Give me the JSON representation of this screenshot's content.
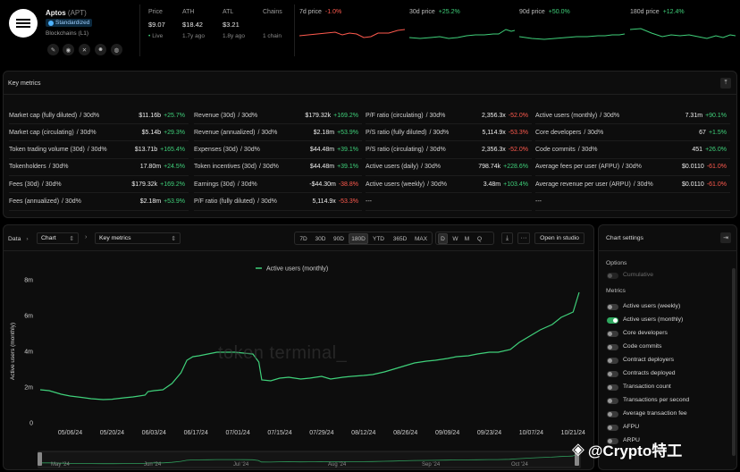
{
  "project": {
    "name": "Aptos",
    "ticker": "(APT)",
    "badge": "Standardized",
    "category": "Blockchains (L1)"
  },
  "header_stats": [
    {
      "label": "Price",
      "value": "$9.07",
      "sub": "Live"
    },
    {
      "label": "ATH",
      "value": "$18.42",
      "sub": "1.7y ago"
    },
    {
      "label": "ATL",
      "value": "$3.21",
      "sub": "1.8y ago"
    },
    {
      "label": "Chains",
      "value": "",
      "sub": "1 chain"
    }
  ],
  "price_changes": [
    {
      "label": "7d price",
      "change": "-1.0%",
      "color": "#ff5a4e"
    },
    {
      "label": "30d price",
      "change": "+25.2%",
      "color": "#3fd07a"
    },
    {
      "label": "90d price",
      "change": "+50.0%",
      "color": "#3fd07a"
    },
    {
      "label": "180d price",
      "change": "+12.4%",
      "color": "#3fd07a"
    }
  ],
  "key_metrics": {
    "title": "Key metrics",
    "columns": [
      [
        {
          "label": "Market cap (fully diluted)",
          "period": "/ 30d%",
          "value": "$11.16b",
          "change": "+25.7%",
          "dir": "up"
        },
        {
          "label": "Market cap (circulating)",
          "period": "/ 30d%",
          "value": "$5.14b",
          "change": "+29.3%",
          "dir": "up"
        },
        {
          "label": "Token trading volume (30d)",
          "period": "/ 30d%",
          "value": "$13.71b",
          "change": "+165.4%",
          "dir": "up"
        },
        {
          "label": "Tokenholders",
          "period": "/ 30d%",
          "value": "17.80m",
          "change": "+24.5%",
          "dir": "up"
        },
        {
          "label": "Fees (30d)",
          "period": "/ 30d%",
          "value": "$179.32k",
          "change": "+169.2%",
          "dir": "up"
        },
        {
          "label": "Fees (annualized)",
          "period": "/ 30d%",
          "value": "$2.18m",
          "change": "+53.9%",
          "dir": "up"
        }
      ],
      [
        {
          "label": "Revenue (30d)",
          "period": "/ 30d%",
          "value": "$179.32k",
          "change": "+169.2%",
          "dir": "up"
        },
        {
          "label": "Revenue (annualized)",
          "period": "/ 30d%",
          "value": "$2.18m",
          "change": "+53.9%",
          "dir": "up"
        },
        {
          "label": "Expenses (30d)",
          "period": "/ 30d%",
          "value": "$44.48m",
          "change": "+39.1%",
          "dir": "up"
        },
        {
          "label": "Token incentives (30d)",
          "period": "/ 30d%",
          "value": "$44.48m",
          "change": "+39.1%",
          "dir": "up"
        },
        {
          "label": "Earnings (30d)",
          "period": "/ 30d%",
          "value": "-$44.30m",
          "change": "-38.8%",
          "dir": "down"
        },
        {
          "label": "P/F ratio (fully diluted)",
          "period": "/ 30d%",
          "value": "5,114.9x",
          "change": "-53.3%",
          "dir": "down"
        }
      ],
      [
        {
          "label": "P/F ratio (circulating)",
          "period": "/ 30d%",
          "value": "2,356.3x",
          "change": "-52.0%",
          "dir": "down"
        },
        {
          "label": "P/S ratio (fully diluted)",
          "period": "/ 30d%",
          "value": "5,114.9x",
          "change": "-53.3%",
          "dir": "down"
        },
        {
          "label": "P/S ratio (circulating)",
          "period": "/ 30d%",
          "value": "2,356.3x",
          "change": "-52.0%",
          "dir": "down"
        },
        {
          "label": "Active users (daily)",
          "period": "/ 30d%",
          "value": "798.74k",
          "change": "+228.6%",
          "dir": "up"
        },
        {
          "label": "Active users (weekly)",
          "period": "/ 30d%",
          "value": "3.48m",
          "change": "+103.4%",
          "dir": "up"
        },
        {
          "label": "---",
          "period": "",
          "value": "",
          "change": "",
          "dir": "up"
        }
      ],
      [
        {
          "label": "Active users (monthly)",
          "period": "/ 30d%",
          "value": "7.31m",
          "change": "+90.1%",
          "dir": "up"
        },
        {
          "label": "Core developers",
          "period": "/ 30d%",
          "value": "67",
          "change": "+1.5%",
          "dir": "up"
        },
        {
          "label": "Code commits",
          "period": "/ 30d%",
          "value": "451",
          "change": "+26.0%",
          "dir": "up"
        },
        {
          "label": "Average fees per user (AFPU)",
          "period": "/ 30d%",
          "value": "$0.0110",
          "change": "-61.0%",
          "dir": "down"
        },
        {
          "label": "Average revenue per user (ARPU)",
          "period": "/ 30d%",
          "value": "$0.0110",
          "change": "-61.0%",
          "dir": "down"
        },
        {
          "label": "---",
          "period": "",
          "value": "",
          "change": "",
          "dir": "up"
        }
      ]
    ]
  },
  "toolbar": {
    "crumb1": "Data",
    "crumb2": "Chart",
    "crumb3": "Key metrics",
    "ranges": [
      "7D",
      "30D",
      "90D",
      "180D",
      "YTD",
      "365D",
      "MAX"
    ],
    "active_range": "180D",
    "granularity": [
      "D",
      "W",
      "M",
      "Q"
    ],
    "active_granularity": "D",
    "more": "···",
    "open_studio": "Open in studio"
  },
  "chart_settings": {
    "title": "Chart settings",
    "options_label": "Options",
    "cumulative": "Cumulative",
    "metrics_label": "Metrics",
    "metrics": [
      {
        "label": "Active users (weekly)",
        "on": false
      },
      {
        "label": "Active users (monthly)",
        "on": true
      },
      {
        "label": "Core developers",
        "on": false
      },
      {
        "label": "Code commits",
        "on": false
      },
      {
        "label": "Contract deployers",
        "on": false
      },
      {
        "label": "Contracts deployed",
        "on": false
      },
      {
        "label": "Transaction count",
        "on": false
      },
      {
        "label": "Transactions per second",
        "on": false
      },
      {
        "label": "Average transaction fee",
        "on": false
      },
      {
        "label": "AFPU",
        "on": false
      },
      {
        "label": "ARPU",
        "on": false
      }
    ]
  },
  "watermark": "token terminal_",
  "overlay_watermark": "@Crypto特工",
  "brush_labels": [
    "May '24",
    "Jun '24",
    "Jul '24",
    "Aug '24",
    "Sep '24",
    "Oct '24"
  ],
  "chart_data": {
    "type": "line",
    "title": "",
    "series": [
      {
        "name": "Active users (monthly)",
        "color": "#3fd07a",
        "x": [
          "2024-04-26",
          "2024-04-29",
          "2024-05-03",
          "2024-05-06",
          "2024-05-10",
          "2024-05-13",
          "2024-05-17",
          "2024-05-20",
          "2024-05-24",
          "2024-05-27",
          "2024-05-29",
          "2024-05-31",
          "2024-06-01",
          "2024-06-03",
          "2024-06-06",
          "2024-06-09",
          "2024-06-12",
          "2024-06-14",
          "2024-06-16",
          "2024-06-18",
          "2024-06-21",
          "2024-06-24",
          "2024-06-27",
          "2024-06-30",
          "2024-07-03",
          "2024-07-06",
          "2024-07-08",
          "2024-07-09",
          "2024-07-12",
          "2024-07-15",
          "2024-07-18",
          "2024-07-22",
          "2024-07-25",
          "2024-07-29",
          "2024-08-01",
          "2024-08-05",
          "2024-08-08",
          "2024-08-12",
          "2024-08-15",
          "2024-08-19",
          "2024-08-22",
          "2024-08-26",
          "2024-08-29",
          "2024-09-02",
          "2024-09-05",
          "2024-09-09",
          "2024-09-12",
          "2024-09-16",
          "2024-09-19",
          "2024-09-23",
          "2024-09-26",
          "2024-09-30",
          "2024-10-03",
          "2024-10-07",
          "2024-10-10",
          "2024-10-14",
          "2024-10-17",
          "2024-10-21",
          "2024-10-23"
        ],
        "y": [
          1.85,
          1.8,
          1.6,
          1.5,
          1.42,
          1.35,
          1.3,
          1.32,
          1.4,
          1.45,
          1.5,
          1.55,
          1.75,
          1.8,
          1.85,
          2.2,
          2.8,
          3.5,
          3.7,
          3.75,
          3.85,
          3.95,
          3.95,
          3.95,
          3.9,
          3.85,
          3.4,
          2.4,
          2.35,
          2.5,
          2.55,
          2.45,
          2.5,
          2.6,
          2.45,
          2.55,
          2.6,
          2.65,
          2.7,
          2.85,
          3.0,
          3.2,
          3.35,
          3.45,
          3.5,
          3.6,
          3.7,
          3.75,
          3.85,
          3.95,
          3.95,
          4.1,
          4.5,
          4.9,
          5.2,
          5.5,
          5.9,
          6.2,
          7.3
        ]
      }
    ],
    "xlabel": "",
    "ylabel": "Active users (monthly)",
    "ylim": [
      0,
      8
    ],
    "yticks": [
      "0",
      "2m",
      "4m",
      "6m",
      "8m"
    ],
    "xticks": [
      "05/06/24",
      "05/20/24",
      "06/03/24",
      "06/17/24",
      "07/01/24",
      "07/15/24",
      "07/29/24",
      "08/12/24",
      "08/26/24",
      "09/09/24",
      "09/23/24",
      "10/07/24",
      "10/21/24"
    ],
    "legend": "top-center",
    "grid": false
  }
}
